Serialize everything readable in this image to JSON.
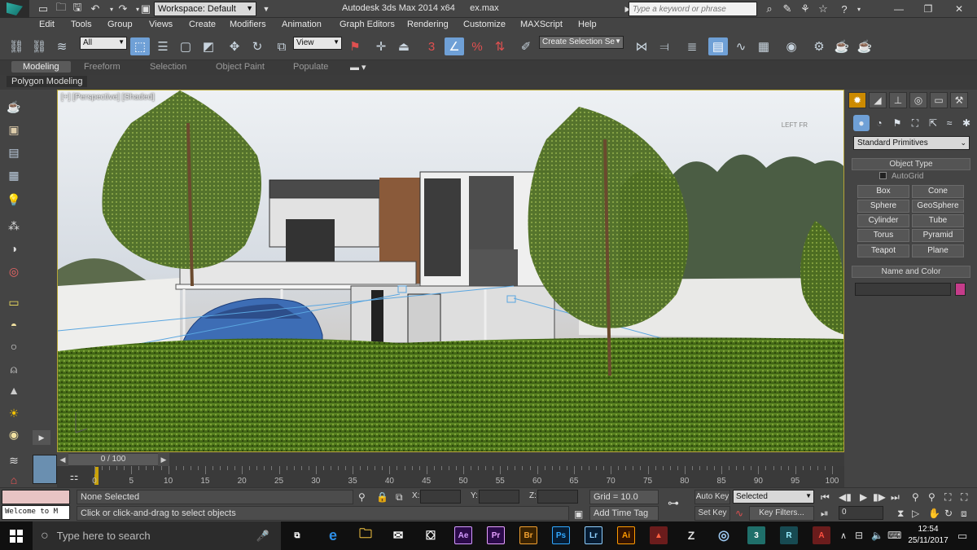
{
  "titlebar": {
    "workspace": "Workspace: Default",
    "app_title": "Autodesk 3ds Max  2014 x64",
    "file_name": "ex.max",
    "search_placeholder": "Type a keyword or phrase"
  },
  "menu": [
    "Edit",
    "Tools",
    "Group",
    "Views",
    "Create",
    "Modifiers",
    "Animation",
    "Graph Editors",
    "Rendering",
    "Customize",
    "MAXScript",
    "Help"
  ],
  "toolbar": {
    "selection_filter": "All",
    "ref_coord": "View",
    "selection_set": "Create Selection Se"
  },
  "ribbon": {
    "tabs": [
      "Modeling",
      "Freeform",
      "Selection",
      "Object Paint",
      "Populate"
    ],
    "panel": "Polygon Modeling"
  },
  "viewport": {
    "label": "[+] [Perspective] [Shaded]",
    "cube_faces": "LEFT   FR"
  },
  "command_panel": {
    "category": "Standard Primitives",
    "object_type_title": "Object Type",
    "autogrid": "AutoGrid",
    "primitives": [
      "Box",
      "Cone",
      "Sphere",
      "GeoSphere",
      "Cylinder",
      "Tube",
      "Torus",
      "Pyramid",
      "Teapot",
      "Plane"
    ],
    "name_color_title": "Name and Color",
    "object_color": "#c53c8a"
  },
  "timeline": {
    "position": "0 / 100",
    "ticks": [
      0,
      5,
      10,
      15,
      20,
      25,
      30,
      35,
      40,
      45,
      50,
      55,
      60,
      65,
      70,
      75,
      80,
      85,
      90,
      95,
      100
    ]
  },
  "status": {
    "listener": "Welcome to M",
    "selection_info": "None Selected",
    "prompt": "Click or click-and-drag to select objects",
    "coords": {
      "x": "X:",
      "y": "Y:",
      "z": "Z:"
    },
    "grid": "Grid = 10.0",
    "add_time_tag": "Add Time Tag",
    "auto_key": "Auto Key",
    "set_key": "Set Key",
    "key_mode": "Selected",
    "key_filters": "Key Filters...",
    "frame": "0"
  },
  "taskbar": {
    "search_placeholder": "Type here to search",
    "apps": [
      {
        "label": "Ae",
        "color": "#2b0a4a",
        "text": "#d49bff"
      },
      {
        "label": "Pr",
        "color": "#2b0a4a",
        "text": "#e6a0ff"
      },
      {
        "label": "Br",
        "color": "#3a2200",
        "text": "#f0a030"
      },
      {
        "label": "Ps",
        "color": "#061c33",
        "text": "#31a8ff"
      },
      {
        "label": "Lr",
        "color": "#061c33",
        "text": "#8fd0ff"
      },
      {
        "label": "Ai",
        "color": "#331300",
        "text": "#ff9a00"
      }
    ],
    "time": "12:54",
    "date": "25/11/2017"
  }
}
